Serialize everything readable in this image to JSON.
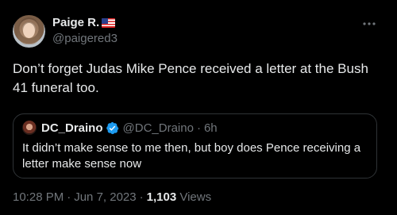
{
  "tweet": {
    "author": {
      "name": "Paige R.",
      "handle": "@paigered3"
    },
    "text": "Don’t forget Judas Mike Pence received a letter at the Bush 41 funeral too.",
    "quoted": {
      "name": "DC_Draino",
      "handle": "@DC_Draino",
      "dot": "·",
      "time": "6h",
      "text": "It didn’t make sense to me then, but boy does Pence receiving a letter make sense now"
    },
    "meta": {
      "time": "10:28 PM",
      "dot": "·",
      "date": "Jun 7, 2023",
      "views_count": "1,103",
      "views_label": "Views"
    }
  },
  "colors": {
    "background": "#000000",
    "primary_text": "#e7e9ea",
    "secondary_text": "#71767b",
    "border": "#2f3336",
    "verified": "#1d9bf0"
  },
  "icons": {
    "more": "more-horizontal-icon",
    "verified": "verified-badge-icon",
    "flag": "us-flag-emoji"
  }
}
